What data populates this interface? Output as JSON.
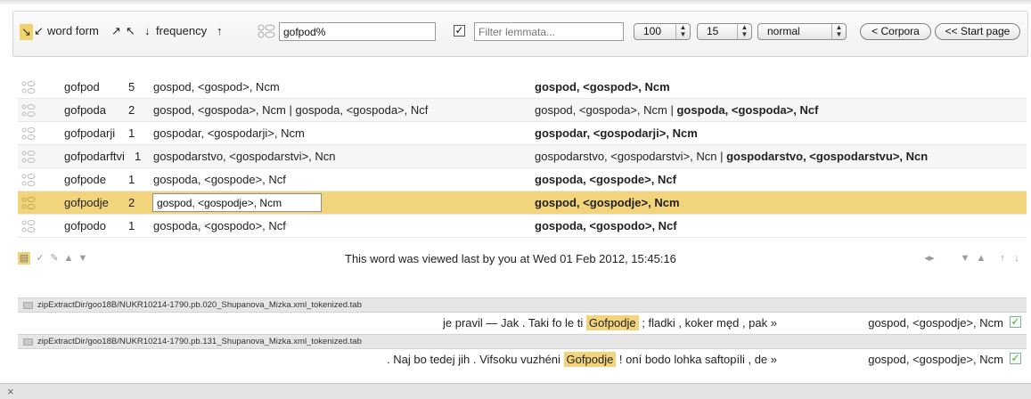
{
  "toolbar": {
    "sort_form_asc": "↘",
    "sort_form_desc": "↙",
    "word_form_label": "word form",
    "sort_freq_up": "↗",
    "sort_freq_down": "↖",
    "freq_arrow_down": "↓",
    "frequency_label": "frequency",
    "freq_arrow_up": "↑",
    "search_value": "gofpod%",
    "filter_checked_mark": "✓",
    "filter_placeholder": "Filter lemmata...",
    "page_size": "100",
    "context_size": "15",
    "mode": "normal",
    "corpora_button": "< Corpora",
    "start_page_button": "<< Start page"
  },
  "rows": [
    {
      "form": "gofpod",
      "freq": "5",
      "list": "gospod, <gospod>, Ncm",
      "lemma_plain": "",
      "lemma_bold": "gospod, <gospod>, Ncm"
    },
    {
      "form": "gofpoda",
      "freq": "2",
      "list": "gospod, <gospoda>, Ncm | gospoda, <gospoda>, Ncf",
      "lemma_plain": "gospod, <gospoda>, Ncm | ",
      "lemma_bold": "gospoda, <gospoda>, Ncf"
    },
    {
      "form": "gofpodarji",
      "freq": "1",
      "list": "gospodar, <gospodarji>, Ncm",
      "lemma_plain": "",
      "lemma_bold": "gospodar, <gospodarji>, Ncm"
    },
    {
      "form": "gofpodarftvi",
      "freq": "1",
      "list": "gospodarstvo, <gospodarstvi>, Ncn",
      "lemma_plain": "gospodarstvo, <gospodarstvi>, Ncn | ",
      "lemma_bold": "gospodarstvo, <gospodarstvu>, Ncn"
    },
    {
      "form": "gofpode",
      "freq": "1",
      "list": "gospoda, <gospode>, Ncf",
      "lemma_plain": "",
      "lemma_bold": "gospoda, <gospode>, Ncf"
    },
    {
      "form": "gofpodje",
      "freq": "2",
      "list": "",
      "edit_value": "gospod, <gospodje>, Ncm",
      "lemma_plain": "",
      "lemma_bold": "gospod, <gospodje>, Ncm"
    },
    {
      "form": "gofpodo",
      "freq": "1",
      "list": "gospoda, <gospodo>, Ncf",
      "lemma_plain": "",
      "lemma_bold": "gospoda, <gospodo>, Ncf"
    }
  ],
  "status": {
    "viewed_text": "This word was viewed last by you at Wed 01 Feb 2012, 15:45:16"
  },
  "contexts": [
    {
      "path": "zipExtractDir/goo18B/NUKR10214-1790.pb.020_Shupanova_Mizka.xml_tokenized.tab",
      "left": "je pravil — Jak . Taki fo le ti ",
      "keyword": "Gofpodje",
      "right": " ; fladki , koker męd , pak »",
      "citation": "gospod, <gospodje>, Ncm"
    },
    {
      "path": "zipExtractDir/goo18B/NUKR10214-1790.pb.131_Shupanova_Mizka.xml_tokenized.tab",
      "left": ". Naj bo tedej jih . Vifsoku vuzhéni ",
      "keyword": "Gofpodje",
      "right": " ! oní bodo lohka saftopíli , de »",
      "citation": "gospod, <gospodje>, Ncm"
    }
  ],
  "bottom": {
    "close_glyph": "×"
  },
  "colors": {
    "selected_row": "#f2d47c",
    "highlight": "#f2d47c"
  }
}
